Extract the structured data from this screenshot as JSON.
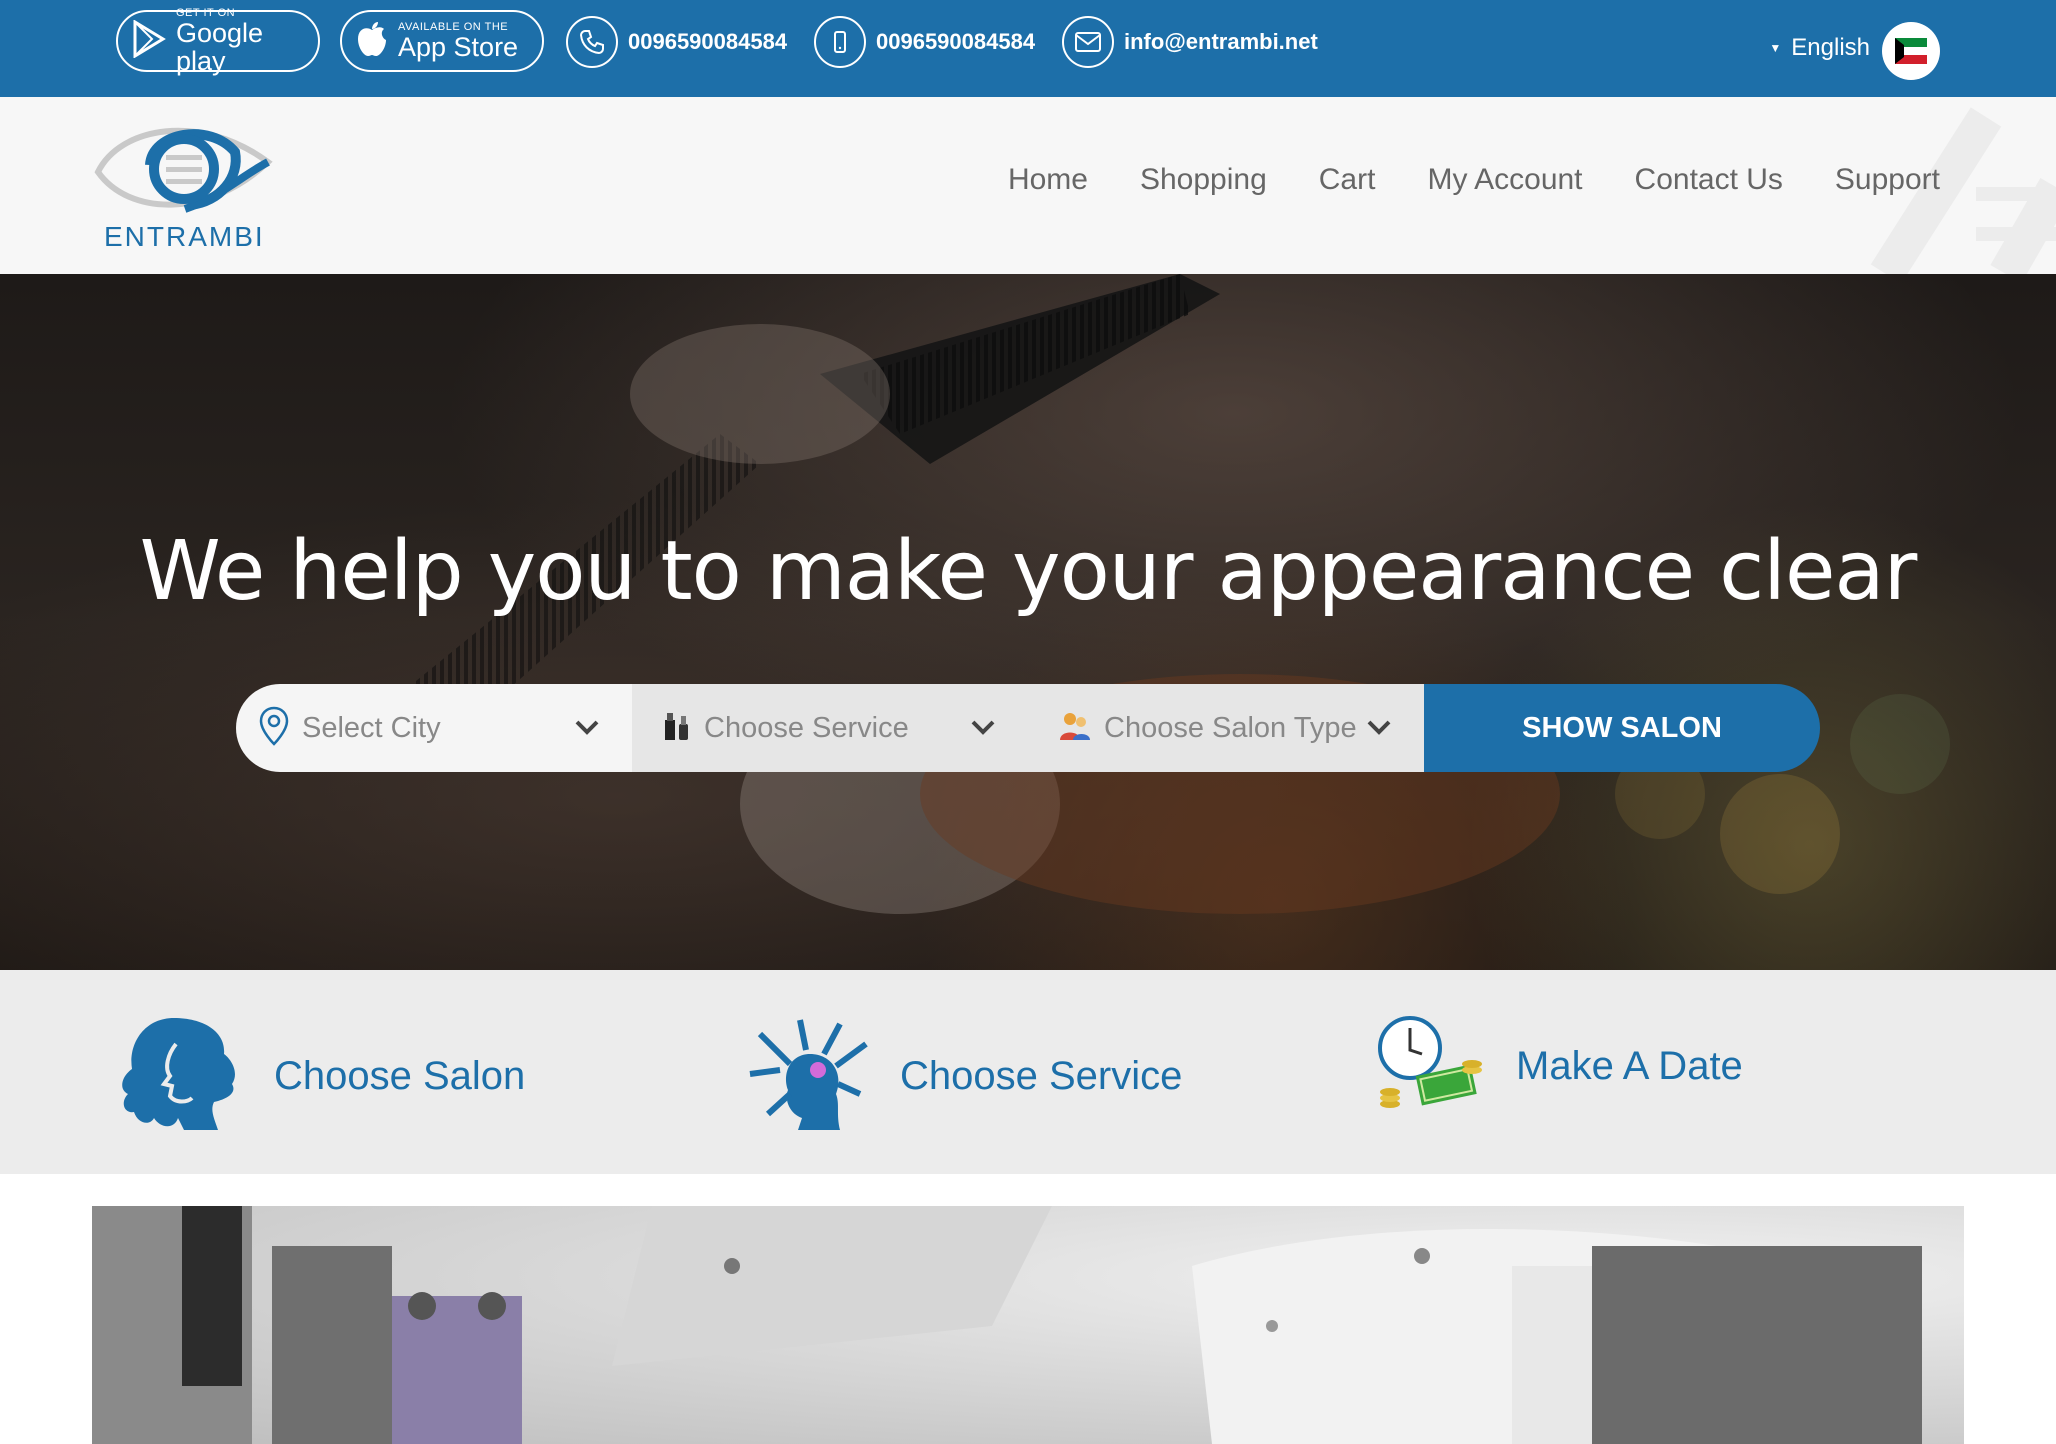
{
  "topbar": {
    "google_play": {
      "small": "GET IT ON",
      "big": "Google play"
    },
    "app_store": {
      "small": "AVAILABLE ON THE",
      "big": "App Store"
    },
    "phone": "0096590084584",
    "mobile": "0096590084584",
    "email": "info@entrambi.net",
    "language": "English",
    "flag_icon": "kuwait-flag-icon"
  },
  "header": {
    "logo_text": "ENTRAMBI",
    "nav": [
      "Home",
      "Shopping",
      "Cart",
      "My Account",
      "Contact Us",
      "Support"
    ]
  },
  "hero": {
    "title": "We help you to make your appearance clear",
    "search": {
      "city": "Select City",
      "service": "Choose Service",
      "salon_type": "Choose Salon Type",
      "button": "SHOW SALON"
    }
  },
  "steps": [
    {
      "label": "Choose Salon",
      "icon": "woman-silhouette-icon"
    },
    {
      "label": "Choose Service",
      "icon": "hair-styling-icon"
    },
    {
      "label": "Make A Date",
      "icon": "clock-money-icon"
    }
  ],
  "colors": {
    "brand": "#1d6fa9",
    "step_bg": "#ececec",
    "header_bg": "#f7f7f7"
  }
}
